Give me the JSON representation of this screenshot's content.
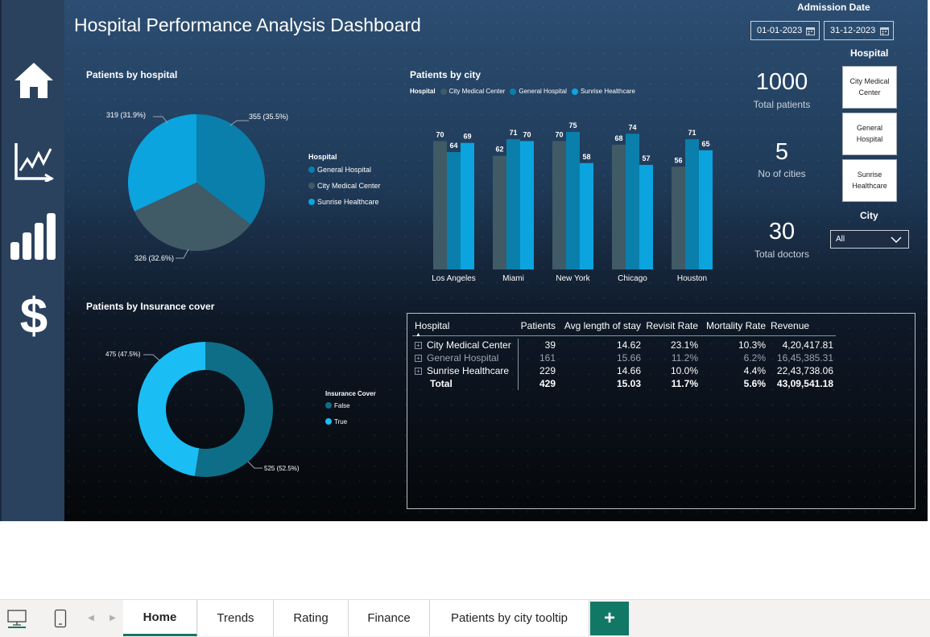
{
  "report": {
    "title": "Hospital Performance Analysis Dashboard",
    "nav_icons": [
      "home-icon",
      "trend-chart-icon",
      "bar-signal-icon",
      "dollar-icon"
    ]
  },
  "colors": {
    "general_hospital": "#0a7fab",
    "city_medical_center": "#405a66",
    "sunrise_healthcare": "#0ba4df",
    "insurance_false": "#0e6e87",
    "insurance_true": "#1abef5",
    "accent_tab": "#117865"
  },
  "filters": {
    "admission_date_label": "Admission Date",
    "start_date": "01-01-2023",
    "end_date": "31-12-2023",
    "hospital_label": "Hospital",
    "hospital_options": [
      "City Medical Center",
      "General Hospital",
      "Sunrise Healthcare"
    ],
    "city_label": "City",
    "city_value": "All"
  },
  "kpis": [
    {
      "value": "1000",
      "label": "Total patients"
    },
    {
      "value": "5",
      "label": "No of cities"
    },
    {
      "value": "30",
      "label": "Total doctors"
    }
  ],
  "pie_hospital": {
    "title": "Patients by hospital",
    "legend_title": "Hospital",
    "legend": [
      "General Hospital",
      "City Medical Center",
      "Sunrise Healthcare"
    ],
    "labels": [
      "355 (35.5%)",
      "326 (32.6%)",
      "319 (31.9%)"
    ]
  },
  "donut_insurance": {
    "title": "Patients by Insurance cover",
    "legend_title": "Insurance Cover",
    "legend": [
      "False",
      "True"
    ],
    "labels": [
      "525 (52.5%)",
      "475 (47.5%)"
    ]
  },
  "bar_city": {
    "title": "Patients by city",
    "legend_title": "Hospital"
  },
  "chart_data": [
    {
      "type": "pie",
      "title": "Patients by hospital",
      "categories": [
        "General Hospital",
        "City Medical Center",
        "Sunrise Healthcare"
      ],
      "values": [
        355,
        326,
        319
      ],
      "legend_placement": "right"
    },
    {
      "type": "pie",
      "title": "Patients by Insurance cover",
      "categories": [
        "False",
        "True"
      ],
      "values": [
        525,
        475
      ],
      "legend_placement": "right"
    },
    {
      "type": "bar",
      "title": "Patients by city",
      "categories": [
        "Los Angeles",
        "Miami",
        "New York",
        "Chicago",
        "Houston"
      ],
      "series": [
        {
          "name": "City Medical Center",
          "values": [
            70,
            62,
            70,
            68,
            56
          ]
        },
        {
          "name": "General Hospital",
          "values": [
            64,
            71,
            75,
            74,
            71
          ]
        },
        {
          "name": "Sunrise Healthcare",
          "values": [
            69,
            70,
            58,
            57,
            65
          ]
        }
      ],
      "ylim": [
        0,
        75
      ],
      "grid": false,
      "legend_placement": "top-left"
    }
  ],
  "matrix": {
    "columns": [
      "Hospital",
      "Patients",
      "Avg length of stay",
      "Revisit Rate",
      "Mortality Rate",
      "Revenue"
    ],
    "rows": [
      {
        "cells": [
          "City Medical Center",
          "39",
          "14.62",
          "23.1%",
          "10.3%",
          "4,20,417.81"
        ]
      },
      {
        "cells": [
          "General Hospital",
          "161",
          "15.66",
          "11.2%",
          "6.2%",
          "16,45,385.31"
        ]
      },
      {
        "cells": [
          "Sunrise Healthcare",
          "229",
          "14.66",
          "10.0%",
          "4.4%",
          "22,43,738.06"
        ]
      }
    ],
    "total": [
      "Total",
      "429",
      "15.03",
      "11.7%",
      "5.6%",
      "43,09,541.18"
    ]
  },
  "tabs": {
    "items": [
      "Home",
      "Trends",
      "Rating",
      "Finance",
      "Patients by city tooltip"
    ],
    "add": "+"
  }
}
